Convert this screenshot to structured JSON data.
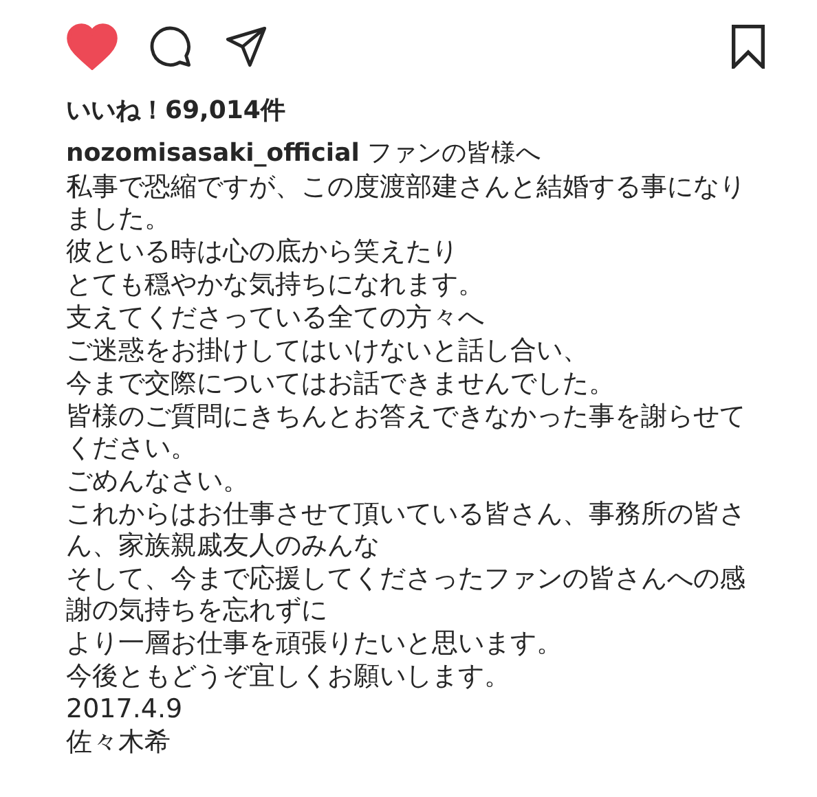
{
  "actions": {
    "liked": true,
    "saved": false
  },
  "likes": "いいね！69,014件",
  "caption": {
    "username": "nozomisasaki_official",
    "title": "ファンの皆様へ",
    "lines": [
      "私事で恐縮ですが、この度渡部建さんと結婚する事になりました。",
      "彼といる時は心の底から笑えたり",
      "とても穏やかな気持ちになれます。",
      "支えてくださっている全ての方々へ",
      "ご迷惑をお掛けしてはいけないと話し合い、",
      "今まで交際についてはお話できませんでした。",
      "皆様のご質問にきちんとお答えできなかった事を謝らせてください。",
      "ごめんなさい。",
      "これからはお仕事させて頂いている皆さん、事務所の皆さん、家族親戚友人のみんな",
      "そして、今まで応援してくださったファンの皆さんへの感謝の気持ちを忘れずに",
      "より一層お仕事を頑張りたいと思います。",
      "今後ともどうぞ宜しくお願いします。",
      "2017.4.9",
      "佐々木希"
    ]
  }
}
